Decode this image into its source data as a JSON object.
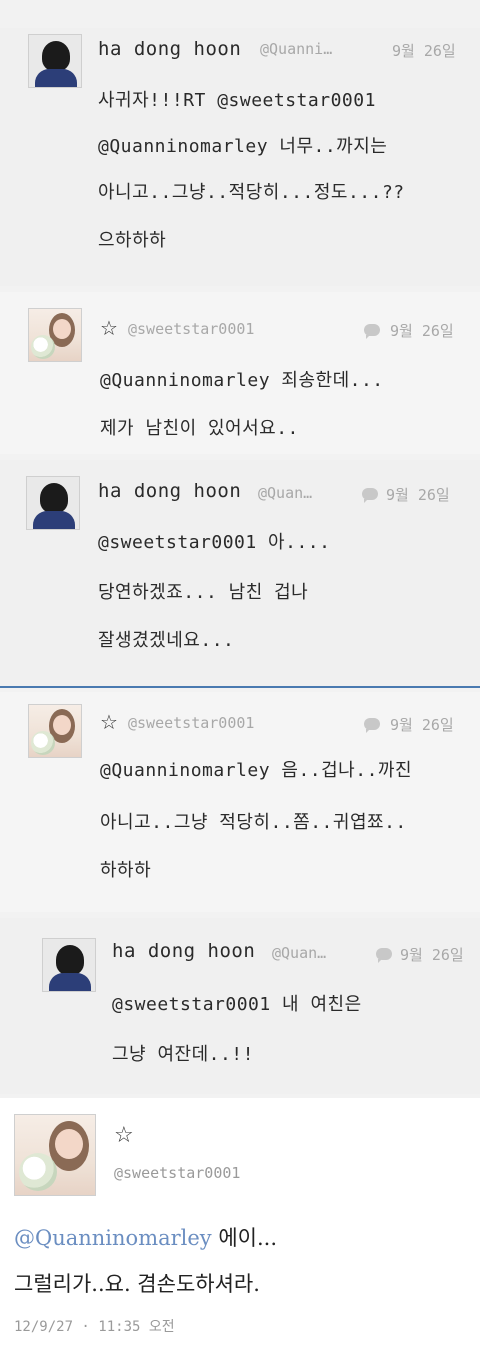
{
  "colors": {
    "mention_blue": "#6b8ec1",
    "meta_gray": "#a8a8a8",
    "divider_blue": "#4a7ab0"
  },
  "tweets": [
    {
      "name": "ha dong hoon",
      "handle": "@Quanni…",
      "date": "9월 26일",
      "lines": [
        "사귀자!!!RT @sweetstar0001",
        "@Quanninomarley 너무..까지는",
        "아니고..그냥..적당히...정도...??",
        "으하하하"
      ]
    },
    {
      "handle": "@sweetstar0001",
      "date": "9월 26일",
      "lines": [
        "@Quanninomarley 죄송한데...",
        "제가 남친이 있어서요.."
      ]
    },
    {
      "name": "ha dong hoon",
      "handle": "@Quan…",
      "date": "9월 26일",
      "lines": [
        "@sweetstar0001 아....",
        "당연하겠죠... 남친 겁나",
        "잘생겼겠네요..."
      ]
    },
    {
      "handle": "@sweetstar0001",
      "date": "9월 26일",
      "lines": [
        "@Quanninomarley 음..겁나..까진",
        "아니고..그냥 적당히..쫌..귀엽쬬..",
        "하하하"
      ]
    },
    {
      "name": "ha dong hoon",
      "handle": "@Quan…",
      "date": "9월 26일",
      "lines": [
        "@sweetstar0001 내 여친은",
        "그냥 여잔데..!!"
      ]
    }
  ],
  "detail": {
    "handle": "@sweetstar0001",
    "mention": "@Quanninomarley",
    "line1_rest": " 에이...",
    "line2": "그럴리가..요. 겸손도하셔라.",
    "timestamp": "12/9/27 · 11:35 오전"
  }
}
